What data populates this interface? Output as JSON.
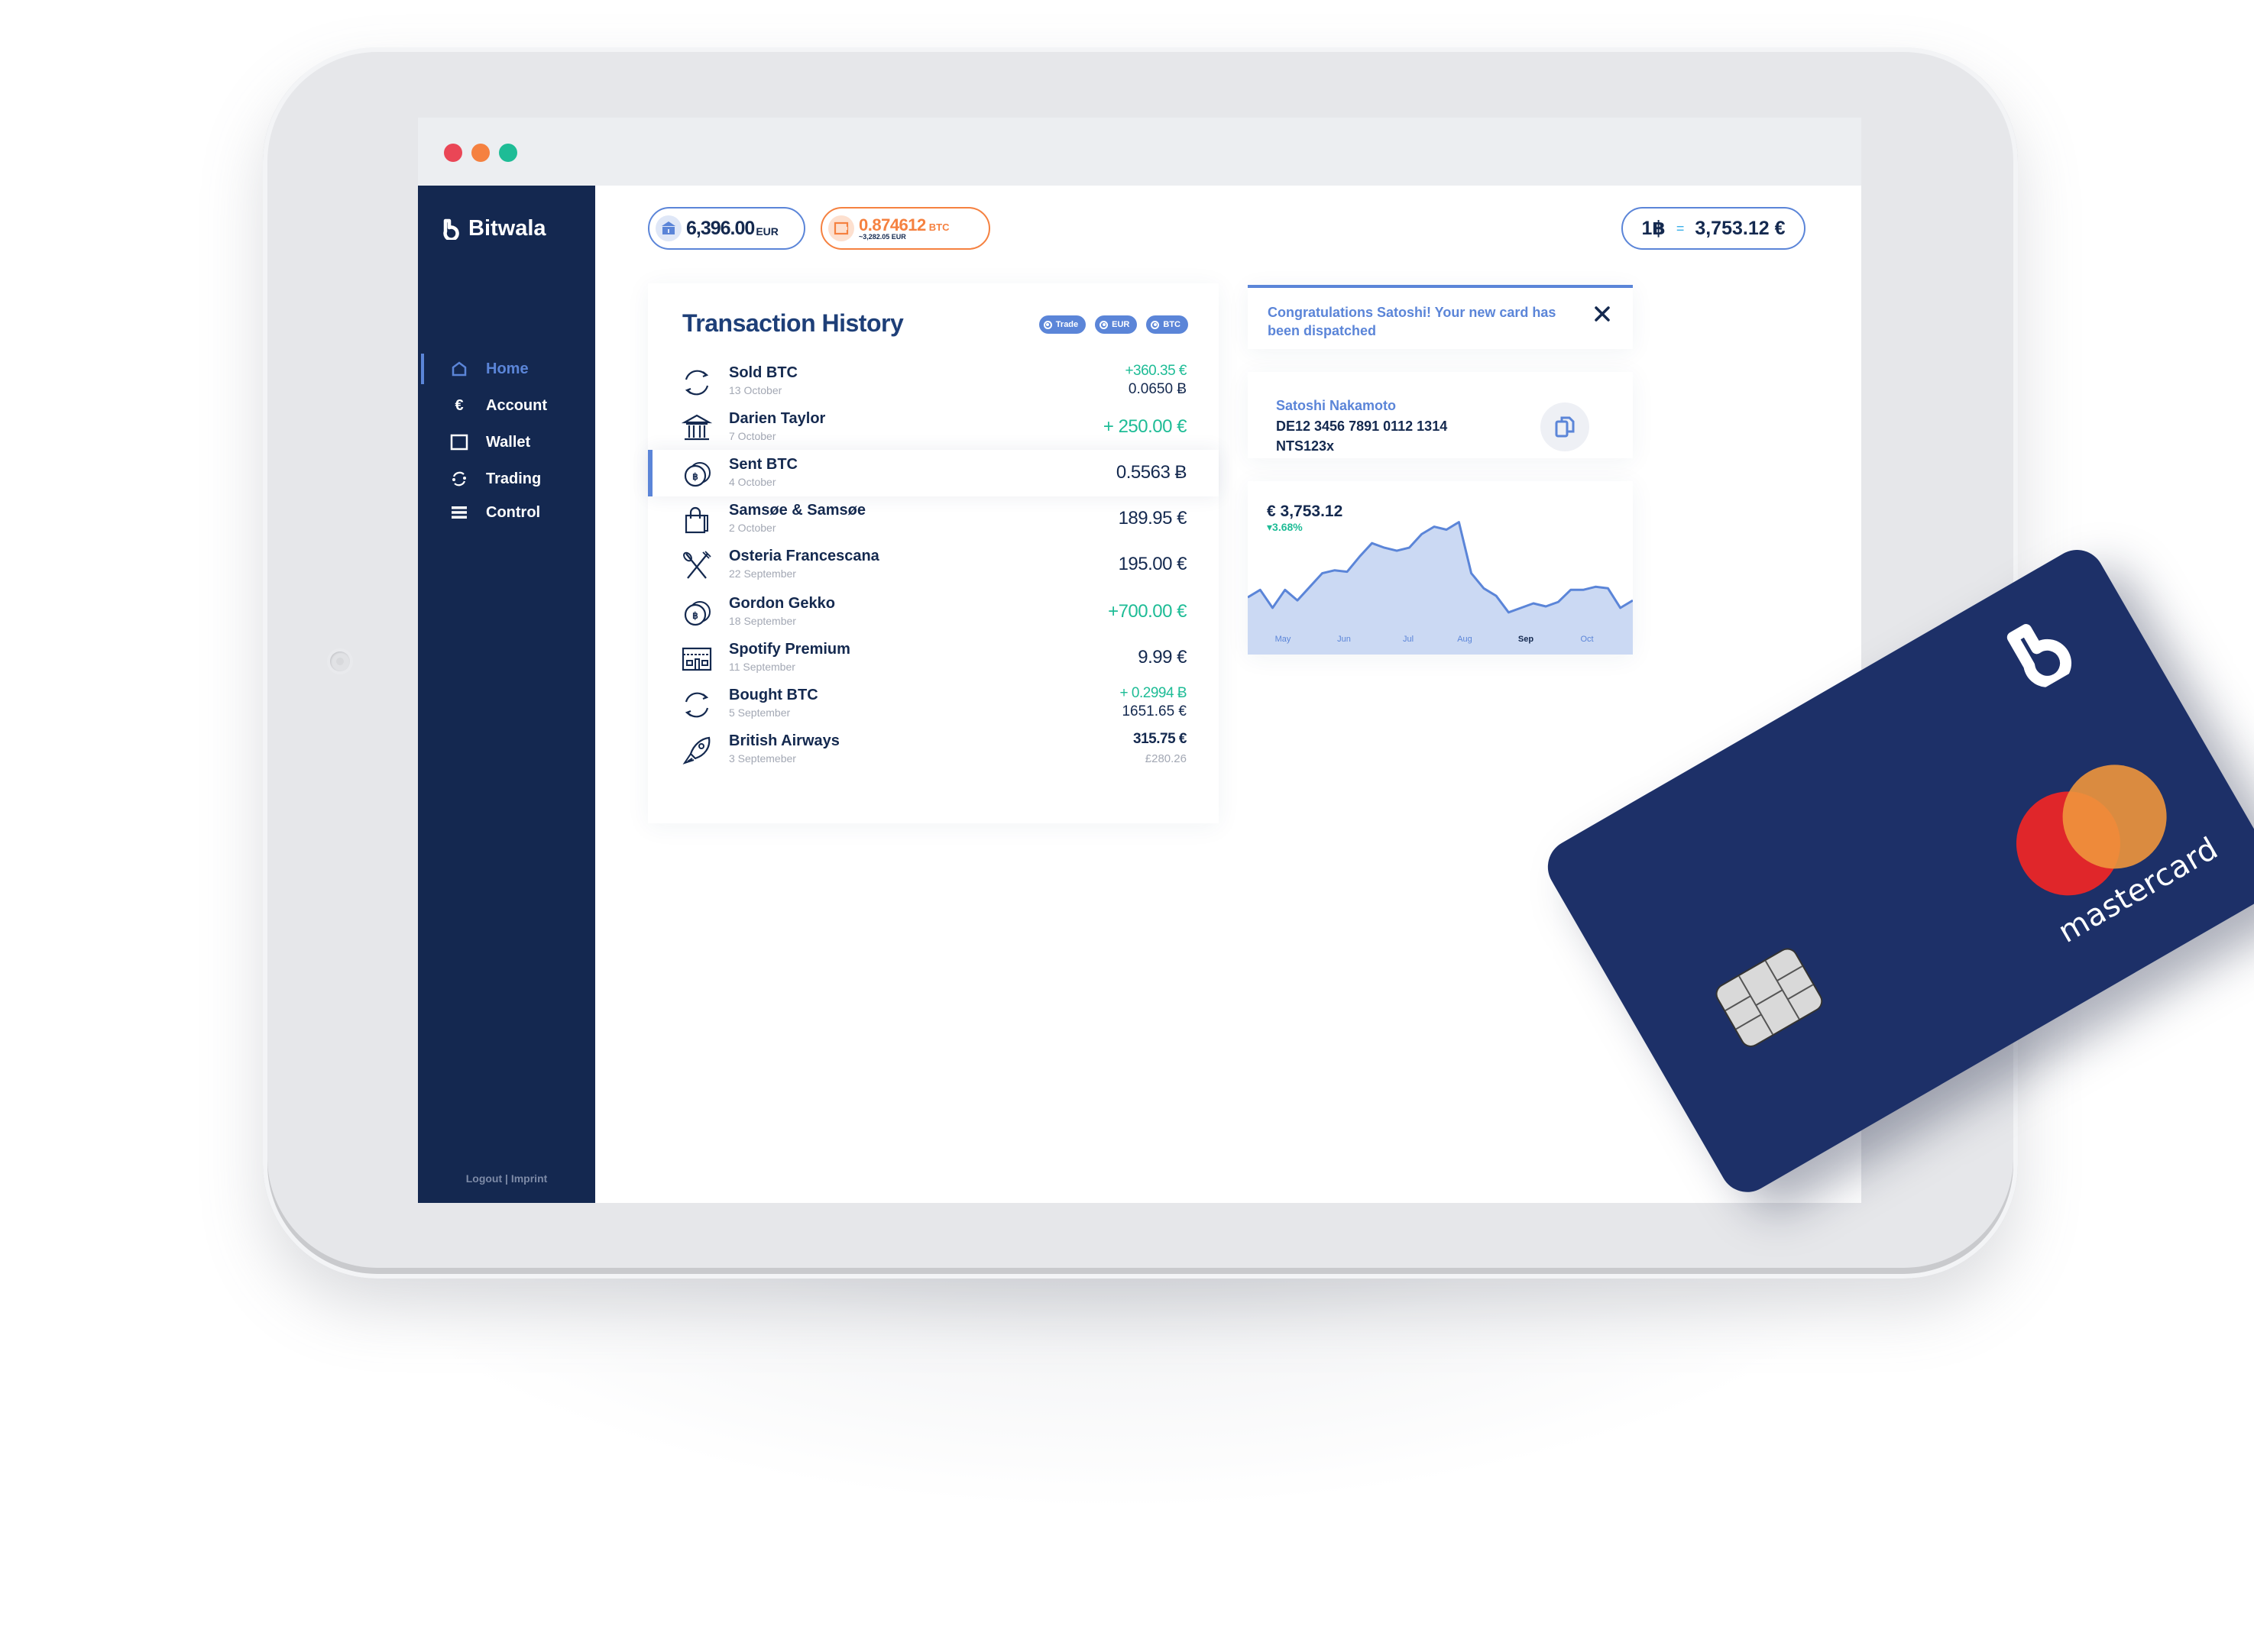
{
  "window": {
    "traffic_lights": [
      {
        "name": "close",
        "color": "#ea4656"
      },
      {
        "name": "minimize",
        "color": "#f58140"
      },
      {
        "name": "maximize",
        "color": "#1ebc96"
      }
    ]
  },
  "brand": {
    "name": "Bitwala",
    "primary": "#142850",
    "accent": "#5b85d8",
    "orange": "#f58140",
    "green": "#1ebc96"
  },
  "sidebar": {
    "items": [
      {
        "label": "Home",
        "icon": "home-icon",
        "active": true
      },
      {
        "label": "Account",
        "icon": "euro-icon",
        "active": false
      },
      {
        "label": "Wallet",
        "icon": "wallet-icon",
        "active": false
      },
      {
        "label": "Trading",
        "icon": "trading-icon",
        "active": false
      },
      {
        "label": "Control",
        "icon": "menu-icon",
        "active": false
      }
    ],
    "footer": "Logout | Imprint"
  },
  "balances": {
    "eur": {
      "amount": "6,396.00",
      "unit": "EUR",
      "icon": "bank-icon"
    },
    "btc": {
      "amount": "0.874612",
      "unit": "BTC",
      "sub": "~3,282.05 EUR",
      "icon": "wallet-icon"
    },
    "rate": {
      "left": "1฿",
      "eq": "=",
      "right": "3,753.12 €"
    }
  },
  "transactions": {
    "title": "Transaction History",
    "filters": [
      "Trade",
      "EUR",
      "BTC"
    ],
    "rows": [
      {
        "name": "Sold BTC",
        "date": "13 October",
        "icon": "exchange-icon",
        "amount": "+360.35 €",
        "amount_positive": true,
        "secondary": "0.0650 Ƀ"
      },
      {
        "name": "Darien Taylor",
        "date": "7 October",
        "icon": "bank-icon",
        "amount": "+ 250.00 €",
        "amount_positive": true,
        "secondary": ""
      },
      {
        "name": "Sent BTC",
        "date": "4 October",
        "icon": "bitcoin-coins-icon",
        "amount": "0.5563 Ƀ",
        "amount_positive": false,
        "secondary": "",
        "selected": true
      },
      {
        "name": "Samsøe & Samsøe",
        "date": "2 October",
        "icon": "shopping-bag-icon",
        "amount": "189.95 €",
        "amount_positive": false,
        "secondary": ""
      },
      {
        "name": "Osteria Francescana",
        "date": "22 September",
        "icon": "cutlery-icon",
        "amount": "195.00 €",
        "amount_positive": false,
        "secondary": ""
      },
      {
        "name": "Gordon Gekko",
        "date": "18 September",
        "icon": "bitcoin-coins-icon",
        "amount": "+700.00 €",
        "amount_positive": true,
        "secondary": ""
      },
      {
        "name": "Spotify Premium",
        "date": "11 September",
        "icon": "store-icon",
        "amount": "9.99 €",
        "amount_positive": false,
        "secondary": ""
      },
      {
        "name": "Bought BTC",
        "date": "5 September",
        "icon": "exchange-icon",
        "amount": "+ 0.2994 Ƀ",
        "amount_positive": true,
        "secondary": "1651.65 €"
      },
      {
        "name": "British Airways",
        "date": "3 Septemeber",
        "icon": "rocket-icon",
        "amount": "315.75 €",
        "amount_positive": false,
        "secondary": "£280.26",
        "secondary_muted": true
      }
    ]
  },
  "notification": {
    "text": "Congratulations Satoshi! Your new card has been dispatched",
    "close_icon": "close-icon"
  },
  "iban_card": {
    "name": "Satoshi Nakamoto",
    "iban": "DE12 3456 7891 0112 1314",
    "bic": "NTS123x",
    "copy_icon": "copy-icon"
  },
  "chart_data": {
    "type": "area",
    "title": "€ 3,753.12",
    "subtitle": "▾3.68%",
    "xlabel": "",
    "ylabel": "",
    "grid": false,
    "x_ticks": [
      "May",
      "Jun",
      "Jul",
      "Aug",
      "Sep",
      "Oct"
    ],
    "active_tick": "Sep",
    "ylim": [
      0,
      100
    ],
    "values": [
      38,
      43,
      31,
      43,
      36,
      45,
      54,
      56,
      55,
      65,
      74,
      71,
      69,
      71,
      80,
      85,
      83,
      88,
      54,
      44,
      39,
      28,
      31,
      34,
      32,
      35,
      43,
      43,
      45,
      44,
      31,
      36
    ],
    "line_color": "#5b85d8",
    "fill_color": "#cbd9f3"
  },
  "card": {
    "network": "mastercard",
    "color": "#1d3068",
    "mc_red": "#e0262a",
    "mc_orange": "#f0963c"
  }
}
